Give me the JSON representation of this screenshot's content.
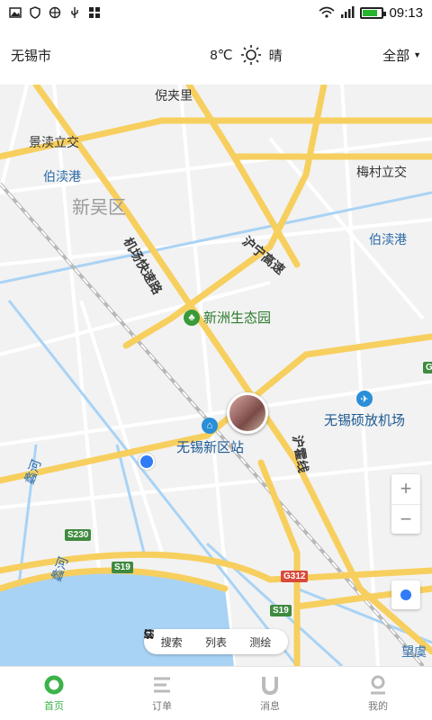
{
  "status": {
    "time": "09:13"
  },
  "header": {
    "city": "无锡市",
    "temp": "8℃",
    "weather": "晴",
    "scope": "全部"
  },
  "map": {
    "labels": {
      "nijiali": "倪夹里",
      "jingdu": "景渎立交",
      "bodugang1": "伯渎港",
      "xinwu": "新吴区",
      "meicun": "梅村立交",
      "bodugang2": "伯渎港",
      "huning": "沪宁高速",
      "jichang": "机场快速路",
      "huhuo": "沪霍线",
      "li1": "蠡河",
      "li2": "蠡河",
      "wangyu": "望虞"
    },
    "pois": {
      "park": "新洲生态园",
      "station": "无锡新区站",
      "airport": "无锡硕放机场"
    },
    "shields": {
      "s230": "S230",
      "s19a": "S19",
      "s19b": "S19",
      "g312": "G312",
      "g": "G"
    }
  },
  "zoom": {
    "in": "+",
    "out": "−"
  },
  "toolbar": {
    "search": "搜索",
    "list": "列表",
    "measure": "测绘"
  },
  "tabs": [
    {
      "label": "首页"
    },
    {
      "label": "订单"
    },
    {
      "label": "消息"
    },
    {
      "label": "我的"
    }
  ],
  "colors": {
    "accent": "#3cb34a",
    "road_main": "#f7cf5e",
    "water": "#a9d3f5",
    "loc": "#2f7cf6"
  }
}
